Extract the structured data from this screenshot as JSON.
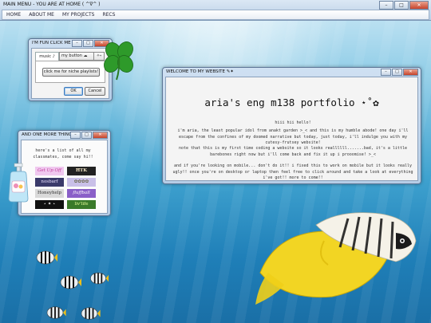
{
  "main_window": {
    "title": "MAIN MENU - YOU ARE AT HOME ( ^∇^ )",
    "menu": [
      "HOME",
      "ABOUT ME",
      "MY PROJECTS",
      "RECS"
    ]
  },
  "fun_window": {
    "title": "I'M FUN CLICK ME ✱",
    "tab_label": "music ♪",
    "select_value": "my button ☁",
    "spin_label": "✧˖",
    "playlist_button": "click me for niche playlists!",
    "ok_label": "OK",
    "cancel_label": "Cancel"
  },
  "website_window": {
    "title": "WELCOME TO MY WEBSITE ✎✦",
    "heading": "aria's eng m138 portfolio ⋆˚✿",
    "greeting": "hiii hii hello!",
    "intro": "i'm aria, the least popular idol from anakt garden >_< and this is my humble abode! one day i'll escape from the confines of my doomed narrative but today, just today, i'll indulge you with my cutesy-frutsey website!",
    "note": "note that this is my first time coding a website so it looks reallllll.......bad, it's a little barebones right now but i'll come back and fix it up i prooomise! >_<",
    "mobile": "and if you're looking on mobile... don't do it!! i fixed this to work on mobile but it looks really ugly!! once you're on desktop or laptop then feel free to click around and take a look at everything i've got!! more to come!!"
  },
  "classmates_window": {
    "title": "AND ONE MORE THING",
    "text": "here's a list of all my classmates, come say hi!!",
    "buttons": [
      "Get Up Off",
      "ĦTK",
      "nosbarf",
      "✿✿✿✿",
      "Honeyhelp",
      "fluffball",
      "⋆ ✦ ⋆",
      "liv'life"
    ]
  },
  "colors": {
    "title_bar": "#c3d7ec",
    "close": "#c8442b",
    "water": "#3fa2cf"
  },
  "icons": [
    "minimize-icon",
    "maximize-icon",
    "close-icon",
    "clover-icon",
    "lotion-bottle-icon",
    "butterflyfish-icon",
    "striped-fish-icon"
  ]
}
